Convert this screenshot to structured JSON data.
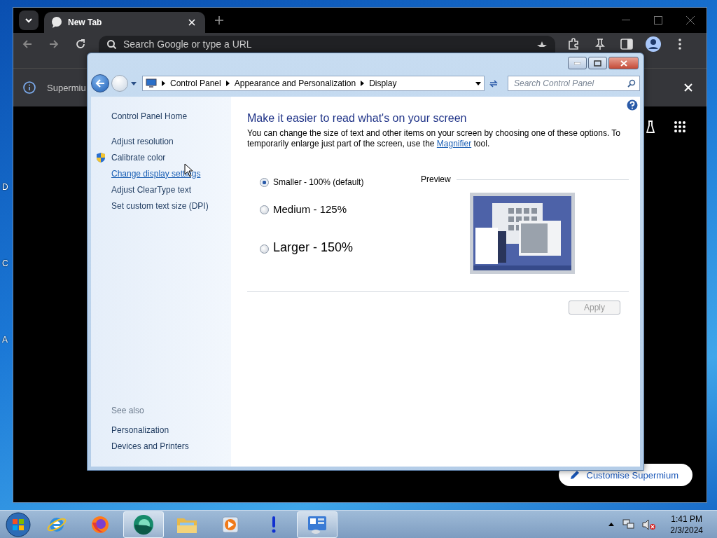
{
  "desktop": {
    "icon_labels": [
      "D",
      "C",
      "A"
    ]
  },
  "browser": {
    "tabs": [
      {
        "label": "New Tab",
        "selected": true
      }
    ],
    "address": {
      "placeholder": "Search Google or type a URL"
    },
    "infobar": {
      "text": "Supermiu"
    },
    "customise_button": "Customise Supermium"
  },
  "control_panel": {
    "breadcrumb": [
      "Control Panel",
      "Appearance and Personalization",
      "Display"
    ],
    "search": {
      "placeholder": "Search Control Panel"
    },
    "sidebar": {
      "items": [
        {
          "label": "Control Panel Home",
          "kind": "home",
          "hovered": false
        },
        {
          "label": "Adjust resolution",
          "kind": "link",
          "hovered": false
        },
        {
          "label": "Calibrate color",
          "kind": "shield",
          "hovered": false
        },
        {
          "label": "Change display settings",
          "kind": "link",
          "hovered": true
        },
        {
          "label": "Adjust ClearType text",
          "kind": "link",
          "hovered": false
        },
        {
          "label": "Set custom text size (DPI)",
          "kind": "link",
          "hovered": false
        }
      ],
      "see_also_title": "See also",
      "see_also": [
        "Personalization",
        "Devices and Printers"
      ]
    },
    "heading": "Make it easier to read what's on your screen",
    "description": {
      "before": "You can change the size of text and other items on your screen by choosing one of these options. To temporarily enlarge just part of the screen, use the",
      "link": "Magnifier",
      "after": "tool."
    },
    "options": [
      {
        "label": "Smaller - 100% (default)",
        "kind": "small",
        "selected": true
      },
      {
        "label": "Medium - 125%",
        "kind": "medium",
        "selected": false
      },
      {
        "label": "Larger - 150%",
        "kind": "large",
        "selected": false
      }
    ],
    "preview_label": "Preview",
    "apply": {
      "label": "Apply",
      "disabled": true
    }
  },
  "taskbar": {
    "apps": [
      {
        "kind": "ie",
        "selected": false
      },
      {
        "kind": "firefox",
        "selected": false
      },
      {
        "kind": "browser",
        "selected": true
      },
      {
        "kind": "explorer",
        "selected": false
      },
      {
        "kind": "media",
        "selected": false
      },
      {
        "kind": "alert",
        "selected": false
      },
      {
        "kind": "controlpanel",
        "selected": true
      }
    ],
    "volume_muted": true,
    "time": "1:41 PM",
    "date": "2/3/2024"
  }
}
